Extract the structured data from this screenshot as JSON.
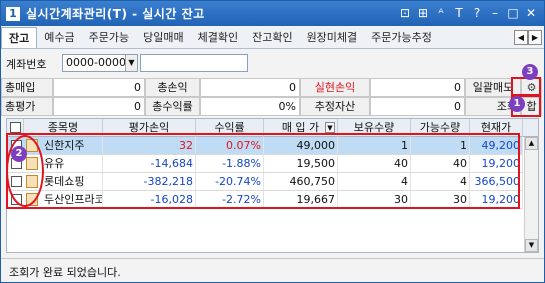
{
  "window": {
    "number": "1",
    "title": "실시간계좌관리(T) - 실시간 잔고",
    "title_icons": [
      "link-icon",
      "restore-icon",
      "font-size-icon",
      "help-icon",
      "minimize-icon",
      "maximize-icon",
      "close-icon"
    ],
    "title_icon_glyphs": [
      "⊡",
      "⊞",
      "ᴬ",
      "T",
      "?",
      "–",
      "□",
      "✕"
    ]
  },
  "tabs": [
    {
      "label": "잔고",
      "active": true
    },
    {
      "label": "예수금",
      "active": false
    },
    {
      "label": "주문가능",
      "active": false
    },
    {
      "label": "당일매매",
      "active": false
    },
    {
      "label": "체결확인",
      "active": false
    },
    {
      "label": "잔고확인",
      "active": false
    },
    {
      "label": "원장미체결",
      "active": false
    },
    {
      "label": "주문가능추정",
      "active": false
    }
  ],
  "account": {
    "label": "계좌번호",
    "number": "0000-0000"
  },
  "summary": {
    "total_buy_label": "총매입",
    "total_buy_value": "0",
    "total_pl_label": "총손익",
    "total_pl_value": "0",
    "realized_pl_label": "실현손익",
    "realized_pl_value": "0",
    "bulk_sell_label": "일괄매도",
    "total_eval_label": "총평가",
    "total_eval_value": "0",
    "total_return_label": "총수익률",
    "total_return_value": "0%",
    "est_assets_label": "추정자산",
    "est_assets_value": "0",
    "query_label": "조회",
    "sum_label": "합"
  },
  "table": {
    "headers": [
      "종목명",
      "평가손익",
      "수익률",
      "매 입 가",
      "보유수량",
      "가능수량",
      "현재가"
    ],
    "rows": [
      {
        "name": "신한지주",
        "pl": "32",
        "rate": "0.07%",
        "price": "49,000",
        "qty": "1",
        "avail": "1",
        "cur": "49,200",
        "pl_color": "red",
        "cur_color": "blue",
        "selected": true
      },
      {
        "name": "유유",
        "pl": "-14,684",
        "rate": "-1.88%",
        "price": "19,500",
        "qty": "40",
        "avail": "40",
        "cur": "19,200",
        "pl_color": "blue",
        "cur_color": "blue",
        "selected": false
      },
      {
        "name": "롯데쇼핑",
        "pl": "-382,218",
        "rate": "-20.74%",
        "price": "460,750",
        "qty": "4",
        "avail": "4",
        "cur": "366,500",
        "pl_color": "blue",
        "cur_color": "blue",
        "selected": false
      },
      {
        "name": "두산인프라코",
        "pl": "-16,028",
        "rate": "-2.72%",
        "price": "19,667",
        "qty": "30",
        "avail": "30",
        "cur": "19,200",
        "pl_color": "blue",
        "cur_color": "blue",
        "selected": false
      }
    ]
  },
  "annotations": {
    "badge1": "1",
    "badge2": "2",
    "badge3": "3"
  },
  "status": {
    "text": "조회가 완료 되었습니다."
  },
  "colors": {
    "title_bar": "#2163b5",
    "highlight": "#e0141e",
    "badge": "#7b3fbf",
    "positive": "#e0141e",
    "negative": "#1446c8",
    "selected_row": "#bfdcf4"
  }
}
